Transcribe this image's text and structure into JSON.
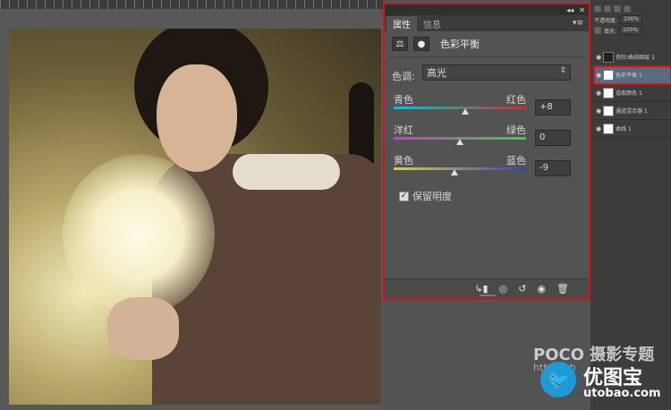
{
  "properties_panel": {
    "tabs": [
      {
        "label": "属性",
        "active": true
      },
      {
        "label": "信息",
        "active": false
      }
    ],
    "header_buttons": [
      "◂◂",
      "✕"
    ],
    "adjustment_title": "色彩平衡",
    "tone": {
      "label": "色调:",
      "value": "高光"
    },
    "sliders": [
      {
        "left": "青色",
        "right": "红色",
        "value": "+8",
        "position": 0.54
      },
      {
        "left": "洋红",
        "right": "绿色",
        "value": "0",
        "position": 0.5
      },
      {
        "left": "黄色",
        "right": "蓝色",
        "value": "-9",
        "position": 0.46
      }
    ],
    "preserve_luminosity": {
      "label": "保留明度",
      "checked": true
    },
    "footer_icons": [
      "clip-to-layer-icon",
      "view-previous-icon",
      "reset-icon",
      "visibility-icon",
      "delete-icon"
    ]
  },
  "layers_panel": {
    "opacity": {
      "label": "不透明度:",
      "value": "100%"
    },
    "fill": {
      "label": "填充:",
      "value": "100%"
    },
    "layers": [
      {
        "name": "色阶/曲线图层 1",
        "thumb": "dark",
        "selected": false
      },
      {
        "name": "色彩平衡 1",
        "thumb": "light",
        "selected": true
      },
      {
        "name": "选取颜色 1",
        "thumb": "light",
        "selected": false
      },
      {
        "name": "通道混合器 1",
        "thumb": "light",
        "selected": false
      },
      {
        "name": "曲线 1",
        "thumb": "light",
        "selected": false
      }
    ]
  },
  "watermarks": {
    "poco": "POCO 摄影专题",
    "poco_url": "http://ph",
    "brand": "优图宝",
    "brand_url": "utobao.com"
  },
  "colors": {
    "highlight": "#d0161c",
    "panel_bg": "#535353",
    "logo_blue": "#1e9ad6"
  }
}
